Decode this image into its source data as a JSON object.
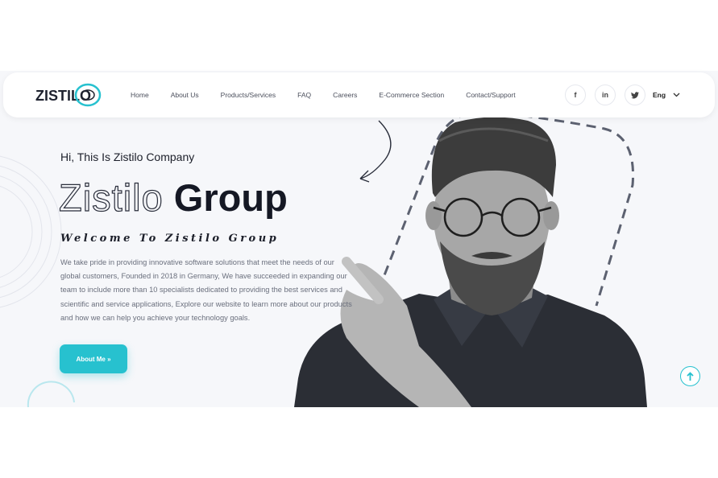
{
  "brand": {
    "logo_text": "ZISTILO"
  },
  "nav": {
    "items": [
      {
        "label": "Home"
      },
      {
        "label": "About Us"
      },
      {
        "label": "Products/Services"
      },
      {
        "label": "FAQ"
      },
      {
        "label": "Careers"
      },
      {
        "label": "E-Commerce Section"
      },
      {
        "label": "Contact/Support"
      }
    ],
    "social": [
      {
        "icon": "facebook-icon",
        "glyph": "f"
      },
      {
        "icon": "linkedin-icon",
        "glyph": "in"
      },
      {
        "icon": "twitter-icon",
        "glyph": "t"
      }
    ],
    "language": "Eng"
  },
  "hero": {
    "greeting": "Hi, This Is Zistilo Company",
    "title_outline": "Zistilo",
    "title_solid": "Group",
    "welcome": "Welcome To Zistilo Group",
    "description": "We take pride in providing innovative software solutions that meet the needs of our global customers, Founded in 2018 in Germany, We have succeeded in expanding our team to include more than 10 specialists dedicated to providing the best services and scientific and service applications, Explore our website to learn more about our products and how we can help you achieve your technology goals.",
    "cta_label": "About Me »"
  },
  "colors": {
    "accent": "#27c1cf",
    "hero_bg": "#f6f7fa",
    "text_dark": "#151824"
  }
}
